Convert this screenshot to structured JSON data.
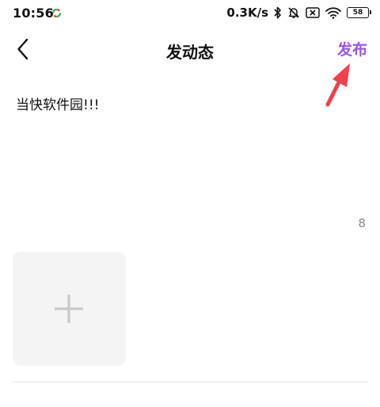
{
  "status_bar": {
    "time": "10:56",
    "net_speed": "0.3K/s",
    "battery_level": "58",
    "icons": [
      "app-dot-icon",
      "bluetooth-icon",
      "mute-bell-icon",
      "sim-x-icon",
      "wifi-icon",
      "battery-icon"
    ]
  },
  "nav": {
    "back_icon": "chevron-left-icon",
    "title": "发动态",
    "publish_label": "发布",
    "publish_color": "#9b55e4"
  },
  "annotation": {
    "arrow_color": "#f0404a"
  },
  "post": {
    "text": "当快软件园!!!",
    "char_count": "8"
  },
  "media": {
    "add_icon": "plus-icon",
    "tile_color": "#f4f4f4"
  }
}
